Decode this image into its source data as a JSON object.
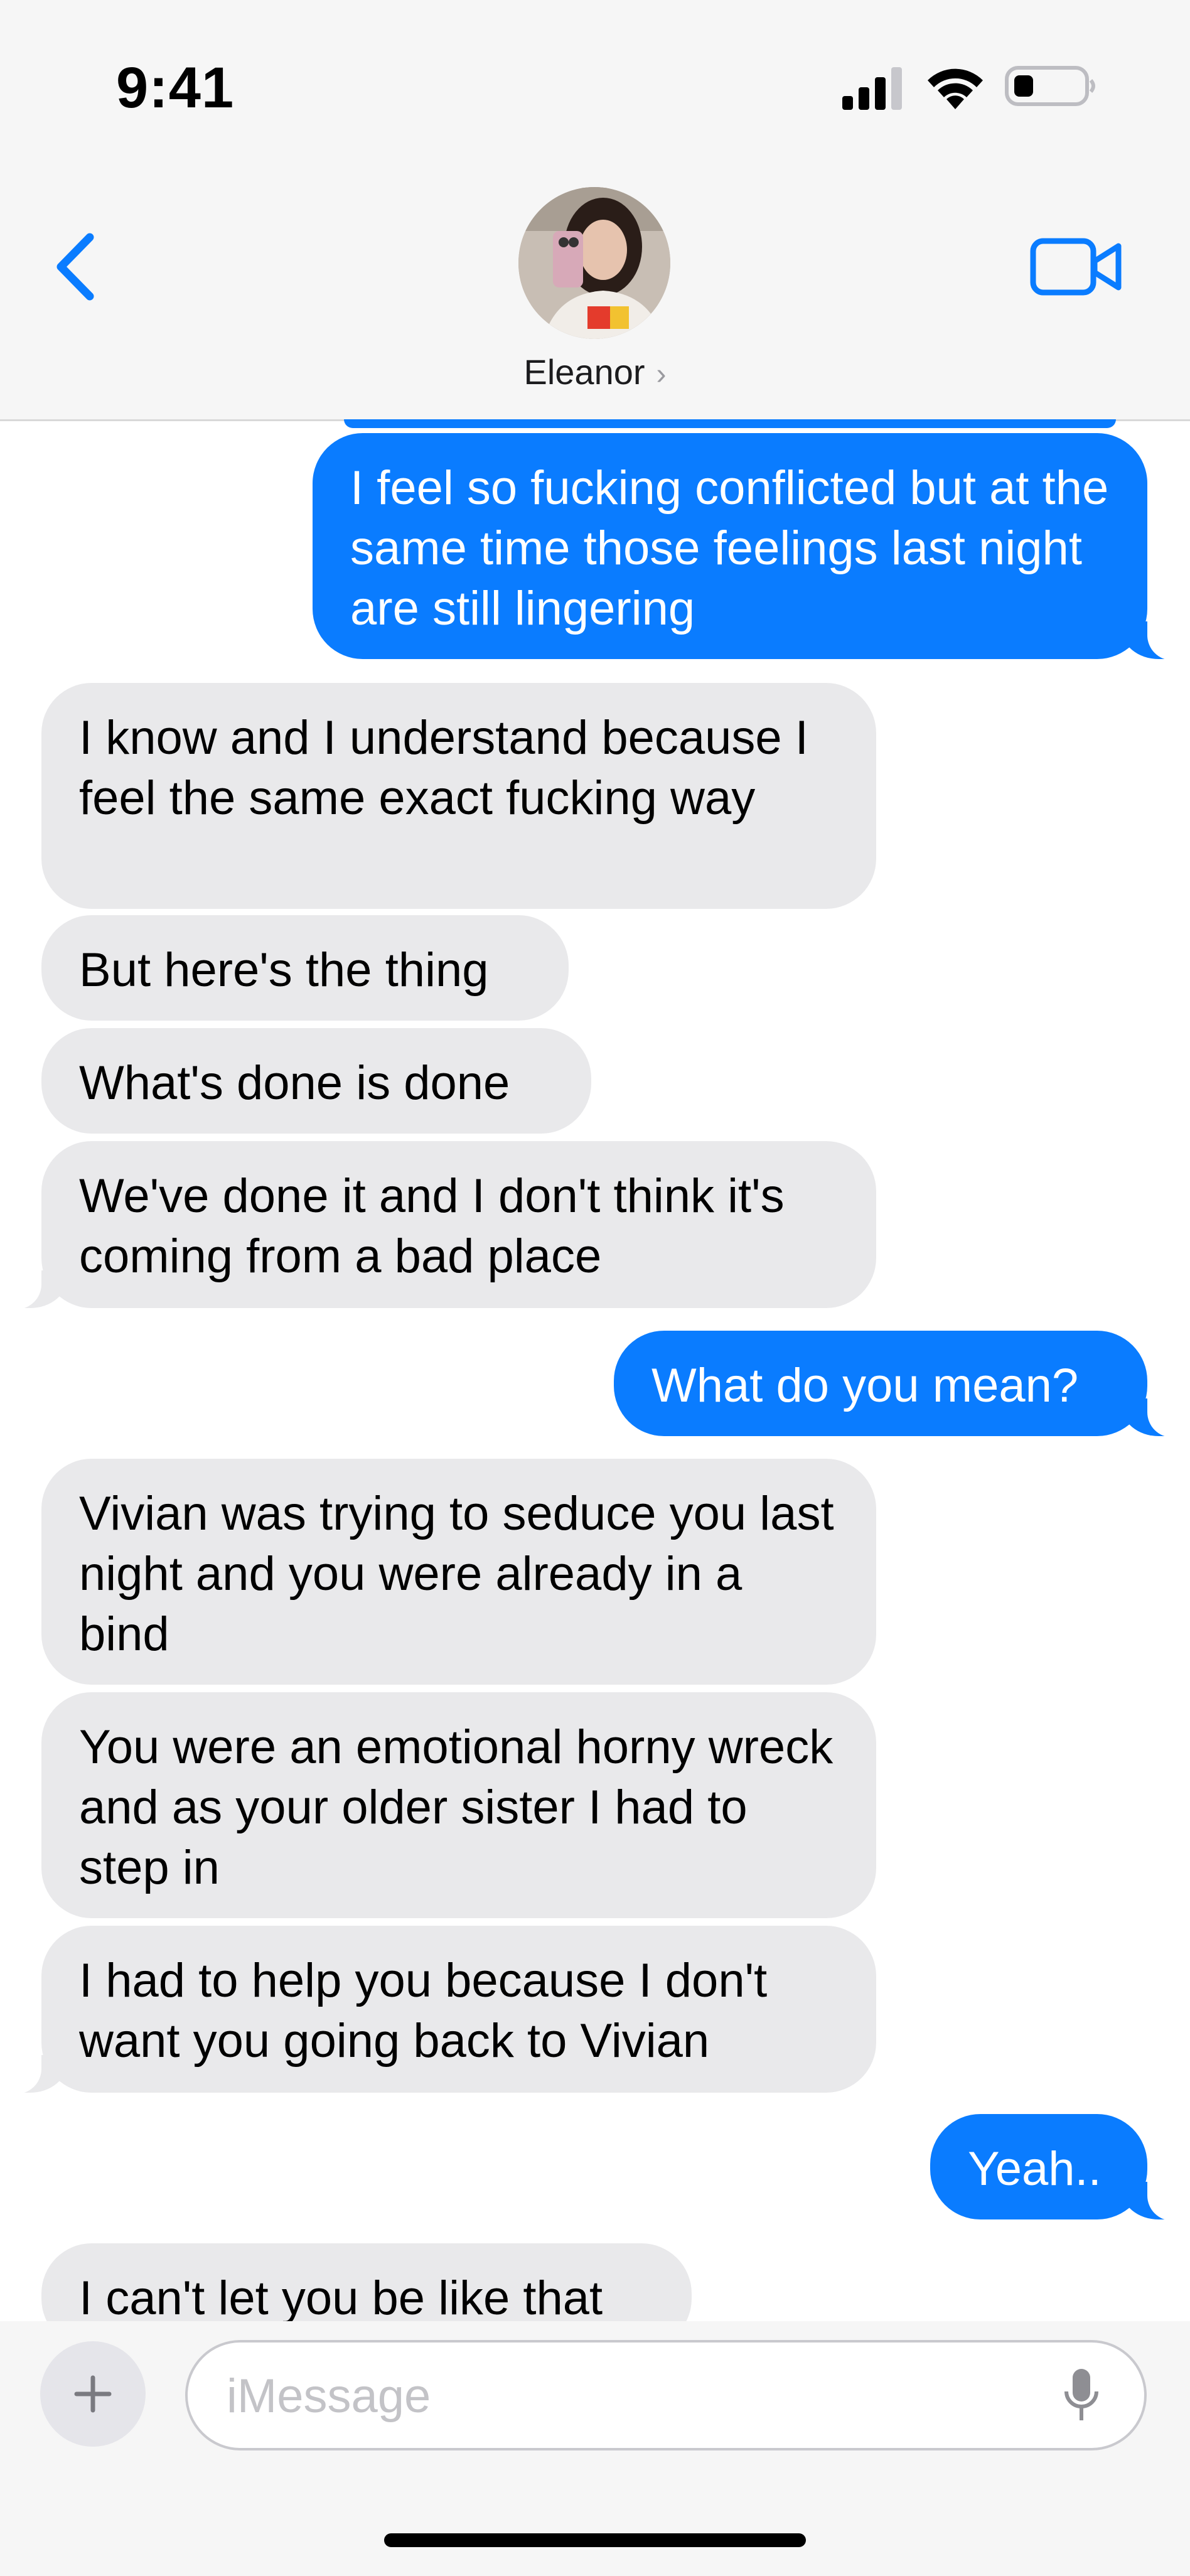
{
  "status_bar": {
    "time": "9:41"
  },
  "nav": {
    "contact_name": "Eleanor",
    "chevron": "›",
    "icons": {
      "back": "chevron-left-icon",
      "video": "video-camera-icon"
    },
    "accent_color": "#0a7cff"
  },
  "messages": [
    {
      "from": "me",
      "text": "I feel so fucking conflicted but at the same time those feelings last night are still lingering"
    },
    {
      "from": "them",
      "text": "I know and I understand because I feel the same exact fucking way"
    },
    {
      "from": "them",
      "text": "But here's the thing"
    },
    {
      "from": "them",
      "text": "What's done is done"
    },
    {
      "from": "them",
      "text": "We've done it and I don't think it's coming from a bad place"
    },
    {
      "from": "me",
      "text": "What do you mean?"
    },
    {
      "from": "them",
      "text": "Vivian was trying to seduce you last night and you were already in a bind"
    },
    {
      "from": "them",
      "text": "You were an emotional horny wreck and as your older sister I had to step in"
    },
    {
      "from": "them",
      "text": "I had to help you because I don't want you going back to Vivian"
    },
    {
      "from": "me",
      "text": "Yeah.."
    },
    {
      "from": "them",
      "text": "I can't let you be like that"
    }
  ],
  "composer": {
    "plus_label": "+",
    "placeholder": "iMessage",
    "value": ""
  },
  "colors": {
    "sent_bubble": "#0a7cff",
    "received_bubble": "#e9e9eb",
    "header_bg": "#f6f6f6"
  }
}
